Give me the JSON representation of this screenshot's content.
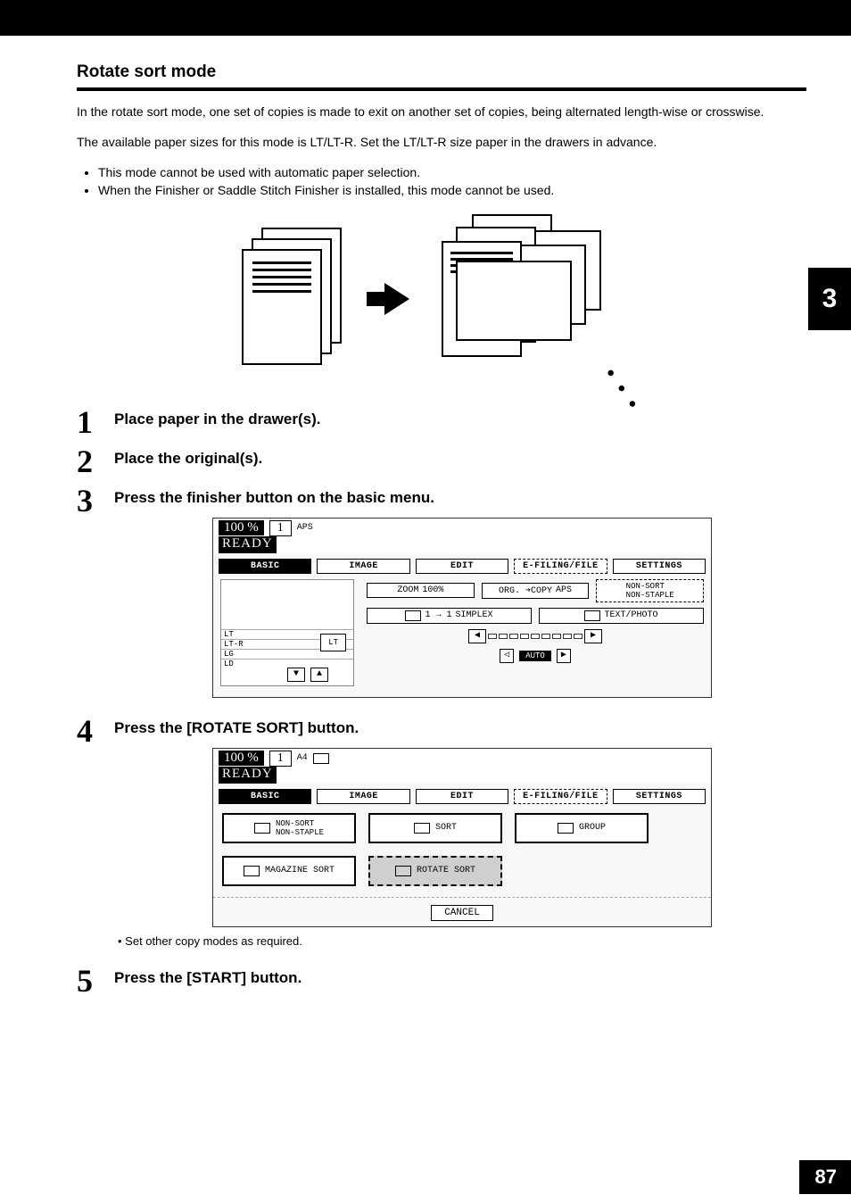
{
  "chapter_tab": "3",
  "page_number": "87",
  "section_title": "Rotate sort mode",
  "intro_p1": "In the rotate sort mode, one set of copies is made to exit on another set of copies, being alternated length-wise or crosswise.",
  "intro_p2": "The available paper sizes for this mode is LT/LT-R. Set the LT/LT-R size paper in the drawers in advance.",
  "notes": {
    "n1": "This mode cannot be used with automatic paper selection.",
    "n2": "When the Finisher or Saddle Stitch Finisher is installed, this mode cannot be used."
  },
  "steps": {
    "s1": "Place paper in the drawer(s).",
    "s2": "Place the original(s).",
    "s3": "Press the finisher button on the basic menu.",
    "s4": "Press the [ROTATE SORT] button.",
    "s4_note": "•  Set other copy modes as required.",
    "s5": "Press the [START] button."
  },
  "panel_a": {
    "percent": "100 %",
    "qty": "1",
    "mode": "APS",
    "status": "READY",
    "tabs": {
      "basic": "BASIC",
      "image": "IMAGE",
      "edit": "EDIT",
      "efile": "E-FILING/FILE",
      "settings": "SETTINGS"
    },
    "drawers": {
      "d1": "LT",
      "d2": "LT-R",
      "d3": "LG",
      "d4": "LD",
      "bypass": "LT"
    },
    "right": {
      "zoom_label": "ZOOM",
      "zoom_value": "100%",
      "org_label": "ORG. ➔COPY",
      "org_value": "APS",
      "finisher": "NON-SORT\nNON-STAPLE",
      "duplex_label": "1 → 1",
      "duplex_value": "SIMPLEX",
      "original_mode": "TEXT/PHOTO",
      "auto": "AUTO"
    }
  },
  "panel_b": {
    "percent": "100 %",
    "qty": "1",
    "paper": "A4",
    "status": "READY",
    "tabs": {
      "basic": "BASIC",
      "image": "IMAGE",
      "edit": "EDIT",
      "efile": "E-FILING/FILE",
      "settings": "SETTINGS"
    },
    "buttons": {
      "nonsort": "NON-SORT\nNON-STAPLE",
      "sort": "SORT",
      "group": "GROUP",
      "magazine": "MAGAZINE SORT",
      "rotate": "ROTATE SORT",
      "cancel": "CANCEL"
    }
  }
}
